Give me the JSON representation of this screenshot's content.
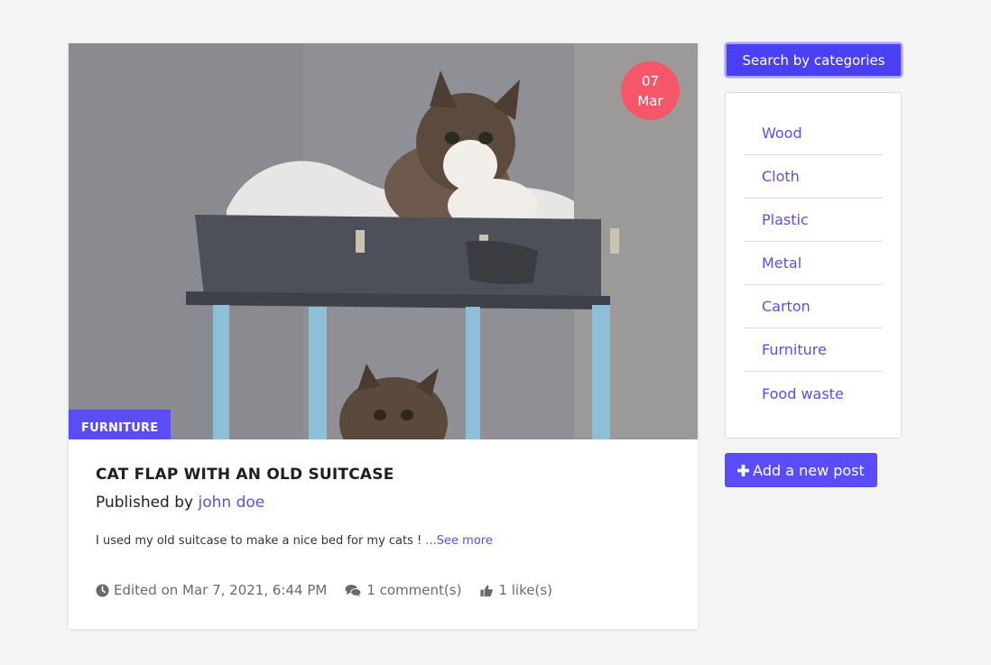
{
  "post": {
    "date_day": "07",
    "date_month": "Mar",
    "category_tag": "FURNITURE",
    "title": "CAT FLAP WITH AN OLD SUITCASE",
    "published_prefix": "Published by",
    "author": "john doe",
    "excerpt": "I used my old suitcase to make a nice bed for my cats !",
    "see_more": "...See more",
    "edited": "Edited on Mar 7, 2021, 6:44 PM",
    "comments": "1 comment(s)",
    "likes": "1 like(s)",
    "image_icon": "photo-cats-in-suitcase"
  },
  "sidebar": {
    "search_label": "Search by categories",
    "categories": [
      "Wood",
      "Cloth",
      "Plastic",
      "Metal",
      "Carton",
      "Furniture",
      "Food waste"
    ],
    "add_post_label": "Add a new post"
  },
  "colors": {
    "accent": "#5a4df5",
    "search_button": "#4a3ff2",
    "date_badge": "#f5566a"
  }
}
